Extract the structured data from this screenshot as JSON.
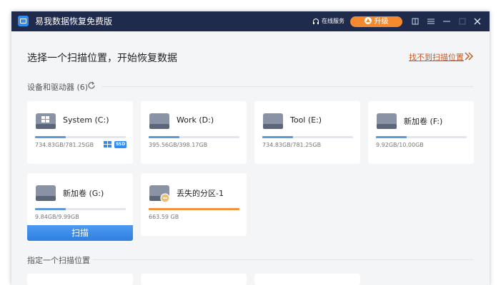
{
  "titlebar": {
    "app_title": "易我数据恢复免费版",
    "support_label": "在线服务",
    "upgrade_label": "升级"
  },
  "header": {
    "heading": "选择一个扫描位置，开始恢复数据",
    "cant_find_link": "找不到扫描位置"
  },
  "devices": {
    "section_label": "设备和驱动器 (6)",
    "drives": [
      {
        "name": "System (C:)",
        "size": "734.83GB/781.25GB",
        "usage": 0.34,
        "badge_ssd": "SSD"
      },
      {
        "name": "Work (D:)",
        "size": "395.56GB/398.17GB",
        "usage": 0.34
      },
      {
        "name": "Tool (E:)",
        "size": "734.83GB/781.25GB",
        "usage": 0.34
      },
      {
        "name": "新加卷 (F:)",
        "size": "9.92GB/10.00GB",
        "usage": 0.34
      },
      {
        "name": "新加卷 (G:)",
        "size": "9.84GB/9.99GB",
        "usage": 0.34,
        "scan_label": "扫描"
      },
      {
        "name": "丢失的分区-1",
        "size": "663.59 GB",
        "usage": 1.0
      }
    ]
  },
  "locations": {
    "section_label": "指定一个扫描位置"
  },
  "colors": {
    "titlebar": "#1f2b4c",
    "accent": "#2f8cf0",
    "upgrade": "#f5892d",
    "link": "#c75b28",
    "usage_bar": "#5b9ad6",
    "lost_partition_bar": "#f0923a"
  }
}
